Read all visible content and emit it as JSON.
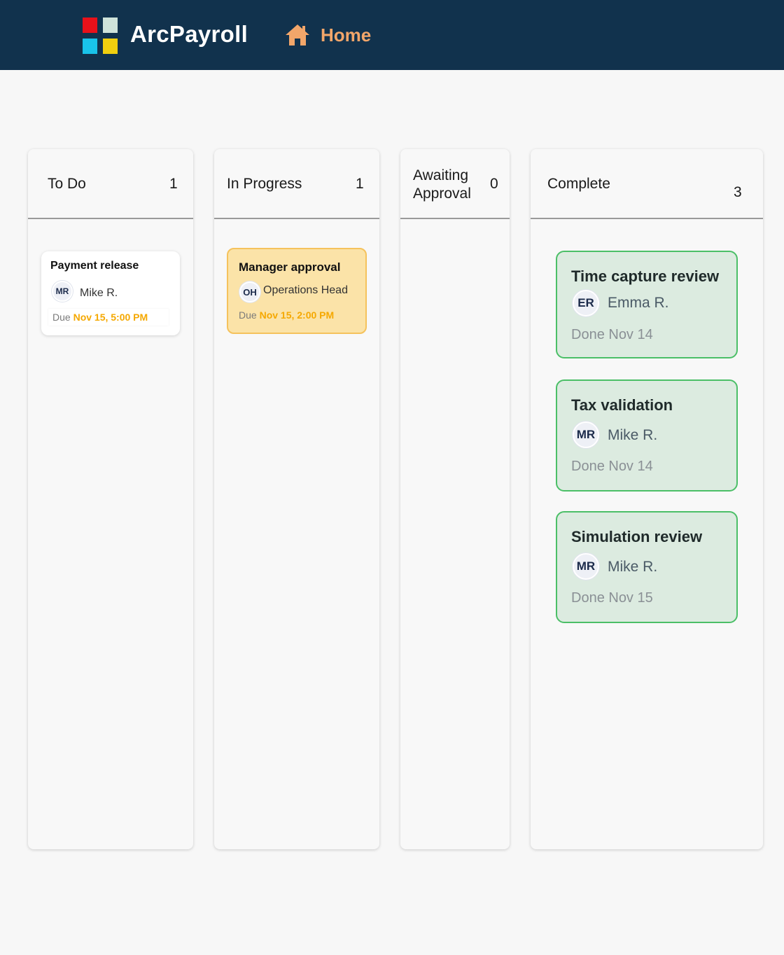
{
  "app": {
    "name": "ArcPayroll",
    "logo_colors": [
      "#e8111a",
      "#cfe3da",
      "#19c3ea",
      "#f0cf0f"
    ]
  },
  "nav": {
    "home_label": "Home",
    "home_icon": "home-icon",
    "accent_color": "#f2a66a"
  },
  "board": {
    "columns": [
      {
        "title": "To Do",
        "count": "1",
        "cards": [
          {
            "title": "Payment release",
            "initials": "MR",
            "assignee": "Mike R.",
            "due_label": "Due",
            "due_date": "Nov 15, 5:00 PM"
          }
        ]
      },
      {
        "title": "In Progress",
        "count": "1",
        "cards": [
          {
            "title": "Manager approval",
            "initials": "OH",
            "assignee": "Operations Head",
            "due_label": "Due",
            "due_date": "Nov 15, 2:00 PM"
          }
        ]
      },
      {
        "title": "Awaiting Approval",
        "count": "0",
        "cards": []
      },
      {
        "title": "Complete",
        "count": "3",
        "cards": [
          {
            "title": "Time capture review",
            "initials": "ER",
            "assignee": "Emma R.",
            "status": "Done Nov 14"
          },
          {
            "title": "Tax validation",
            "initials": "MR",
            "assignee": "Mike R.",
            "status": "Done Nov 14"
          },
          {
            "title": "Simulation review",
            "initials": "MR",
            "assignee": "Mike R.",
            "status": "Done Nov 15"
          }
        ]
      }
    ]
  }
}
